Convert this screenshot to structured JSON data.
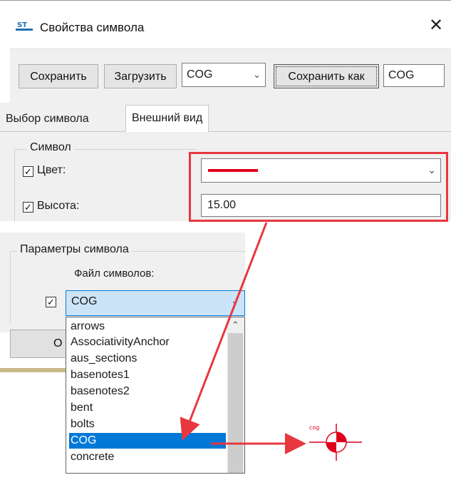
{
  "window": {
    "title": "Свойства символа",
    "close_glyph": "✕"
  },
  "toolbar": {
    "save_label": "Сохранить",
    "load_label": "Загрузить",
    "preset_value": "COG",
    "save_as_label": "Сохранить как",
    "save_as_name": "COG"
  },
  "tabs": [
    {
      "label": "Выбор символа",
      "active": false
    },
    {
      "label": "Внешний вид",
      "active": true
    }
  ],
  "symbol_group": {
    "title": "Символ",
    "color": {
      "label": "Цвет:",
      "checked": true,
      "value_color": "#e0001b"
    },
    "height": {
      "label": "Высота:",
      "checked": true,
      "value": "15.00"
    }
  },
  "params_group": {
    "title": "Параметры символа",
    "file_label": "Файл символов:",
    "file_checked": true,
    "file_value": "COG",
    "partial_button_label": "O"
  },
  "dropdown": {
    "items": [
      "arrows",
      "AssociativityAnchor",
      "aus_sections",
      "basenotes1",
      "basenotes2",
      "bent",
      "bolts",
      "COG",
      "concrete"
    ],
    "selected_index": 7
  },
  "symbol_preview": {
    "label": "cog"
  },
  "colors": {
    "highlight": "#e8373f",
    "selection": "#0078d7",
    "symbol_red": "#e0001b"
  },
  "icons": {
    "checkbox": "check-icon",
    "chevron": "chevron-down-icon",
    "scroll_up": "chevron-up-icon"
  }
}
